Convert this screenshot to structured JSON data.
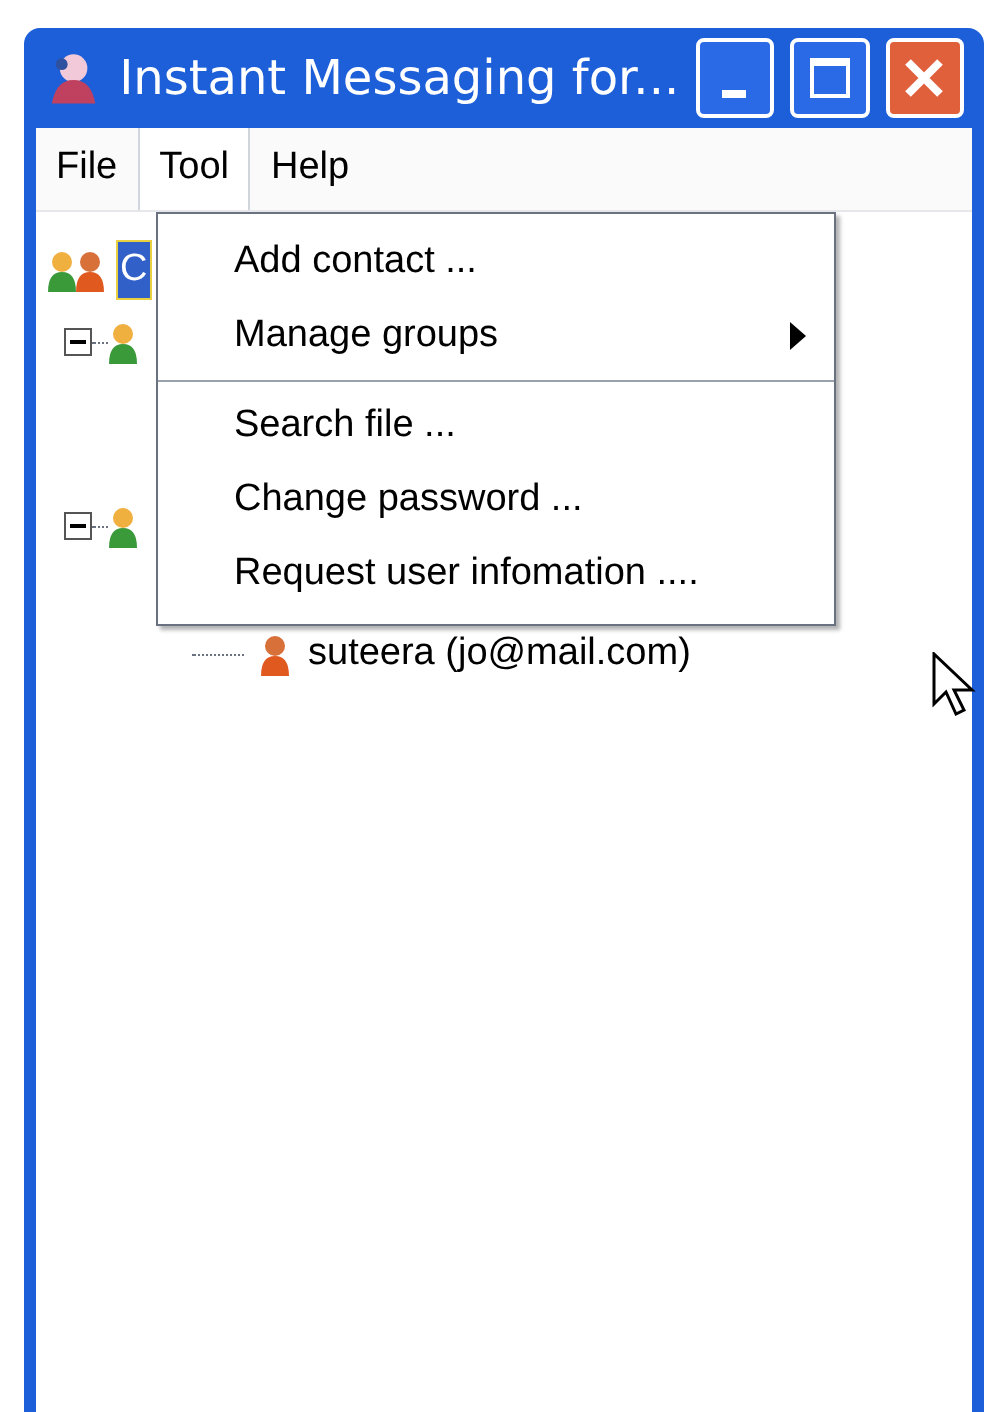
{
  "window": {
    "title": "Instant Messaging for..."
  },
  "menubar": [
    {
      "label": "File",
      "selected": false
    },
    {
      "label": "Tool",
      "selected": true
    },
    {
      "label": "Help",
      "selected": false
    }
  ],
  "menu": [
    {
      "kind": "item",
      "label": "Add contact ..."
    },
    {
      "kind": "submenu",
      "label": "Manage groups"
    },
    {
      "kind": "separator"
    },
    {
      "kind": "item",
      "label": "Search file ..."
    },
    {
      "kind": "item",
      "label": "Change password ..."
    },
    {
      "kind": "item",
      "label": "Request user infomation ...."
    }
  ],
  "tree": {
    "label": "C",
    "selected": true,
    "children": [
      {
        "expanded": true
      },
      {
        "expanded": true,
        "children": [
          {
            "label": "suteera (jo@mail.com)"
          }
        ]
      }
    ]
  }
}
